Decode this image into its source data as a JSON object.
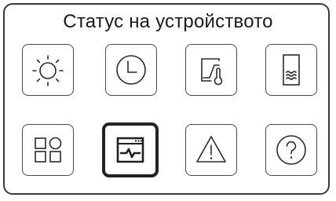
{
  "header": {
    "title": "Статус на устройството"
  },
  "tiles": [
    {
      "id": "sun",
      "icon": "sun-icon",
      "selected": false
    },
    {
      "id": "clock",
      "icon": "clock-icon",
      "selected": false
    },
    {
      "id": "curve-thermo",
      "icon": "curve-thermometer-icon",
      "selected": false
    },
    {
      "id": "water-tank",
      "icon": "water-tank-icon",
      "selected": false
    },
    {
      "id": "apps",
      "icon": "apps-grid-icon",
      "selected": false
    },
    {
      "id": "monitor",
      "icon": "operation-monitor-icon",
      "selected": true
    },
    {
      "id": "warning",
      "icon": "warning-icon",
      "selected": false
    },
    {
      "id": "help",
      "icon": "help-icon",
      "selected": false
    }
  ],
  "colors": {
    "stroke": "#2b2b2b",
    "selected_border": "#222222"
  }
}
